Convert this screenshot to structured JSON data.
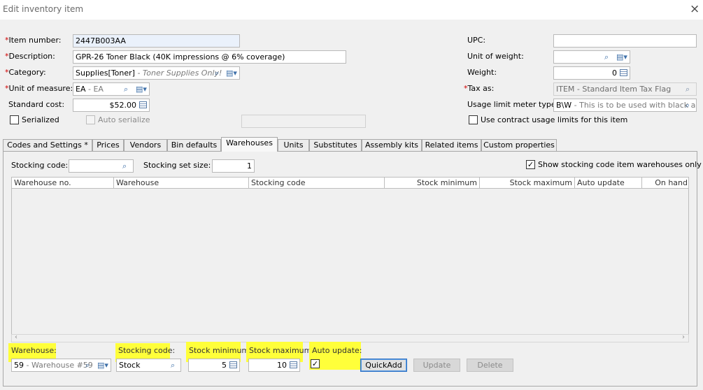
{
  "window": {
    "title": "Edit inventory item",
    "close_icon": "×"
  },
  "general": {
    "item_number": {
      "label": "Item number:",
      "value": "2447B003AA"
    },
    "description": {
      "label": "Description:",
      "value": "GPR-26 Toner Black (40K impressions @ 6% coverage)"
    },
    "category": {
      "label": "Category:",
      "value": "Supplies[Toner]",
      "hint": " - Toner Supplies Only!"
    },
    "unit_of_measure": {
      "label": "Unit of measure:",
      "value": "EA",
      "hint": " - EA"
    },
    "standard_cost": {
      "label": "Standard cost:",
      "value": "$52.00"
    },
    "serialized": {
      "label": "Serialized",
      "checked": false
    },
    "auto_serialize": {
      "label": "Auto serialize",
      "checked": false
    },
    "upc": {
      "label": "UPC:",
      "value": ""
    },
    "unit_of_weight": {
      "label": "Unit of weight:",
      "value": ""
    },
    "weight": {
      "label": "Weight:",
      "value": "0"
    },
    "tax_as": {
      "label": "Tax as:",
      "value": "ITEM - Standard Item Tax Flag"
    },
    "usage_limit_meter_type": {
      "label": "Usage limit meter type:",
      "value": "B\\W",
      "hint": " - This is to be used with black and"
    },
    "use_contract_usage_limits": {
      "label": "Use contract usage limits for this item",
      "checked": false
    }
  },
  "tabs": [
    {
      "label": "Codes and Settings  *",
      "active": false
    },
    {
      "label": "Prices",
      "active": false
    },
    {
      "label": "Vendors",
      "active": false
    },
    {
      "label": "Bin defaults",
      "active": false
    },
    {
      "label": "Warehouses",
      "active": true
    },
    {
      "label": "Units",
      "active": false
    },
    {
      "label": "Substitutes",
      "active": false
    },
    {
      "label": "Assembly kits",
      "active": false
    },
    {
      "label": "Related items",
      "active": false
    },
    {
      "label": "Custom properties",
      "active": false
    }
  ],
  "warehouses_tab": {
    "stocking_code": {
      "label": "Stocking code:",
      "value": ""
    },
    "stocking_set_size": {
      "label": "Stocking set size:",
      "value": "1"
    },
    "show_stocking_only": {
      "label": "Show stocking code item warehouses only",
      "checked": true
    },
    "columns": [
      "Warehouse no.",
      "Warehouse",
      "Stocking code",
      "Stock minimum",
      "Stock maximum",
      "Auto update",
      "On hand"
    ],
    "rows": []
  },
  "entry": {
    "warehouse": {
      "label": "Warehouse:",
      "value": "59",
      "hint": " - Warehouse #59"
    },
    "stocking_code": {
      "label": "Stocking code:",
      "value": "Stock"
    },
    "stock_minimum": {
      "label": "Stock minimum:",
      "value": "5"
    },
    "stock_maximum": {
      "label": "Stock maximum:",
      "value": "10"
    },
    "auto_update": {
      "label": "Auto update:",
      "checked": true
    },
    "highlight_color": "#ffff3a"
  },
  "buttons": {
    "quickadd": "QuickAdd",
    "update": "Update",
    "delete": "Delete"
  },
  "icons": {
    "search": "search-icon",
    "dropdown": "dropdown-icon",
    "calendar": "calendar-icon",
    "check": "✓"
  }
}
